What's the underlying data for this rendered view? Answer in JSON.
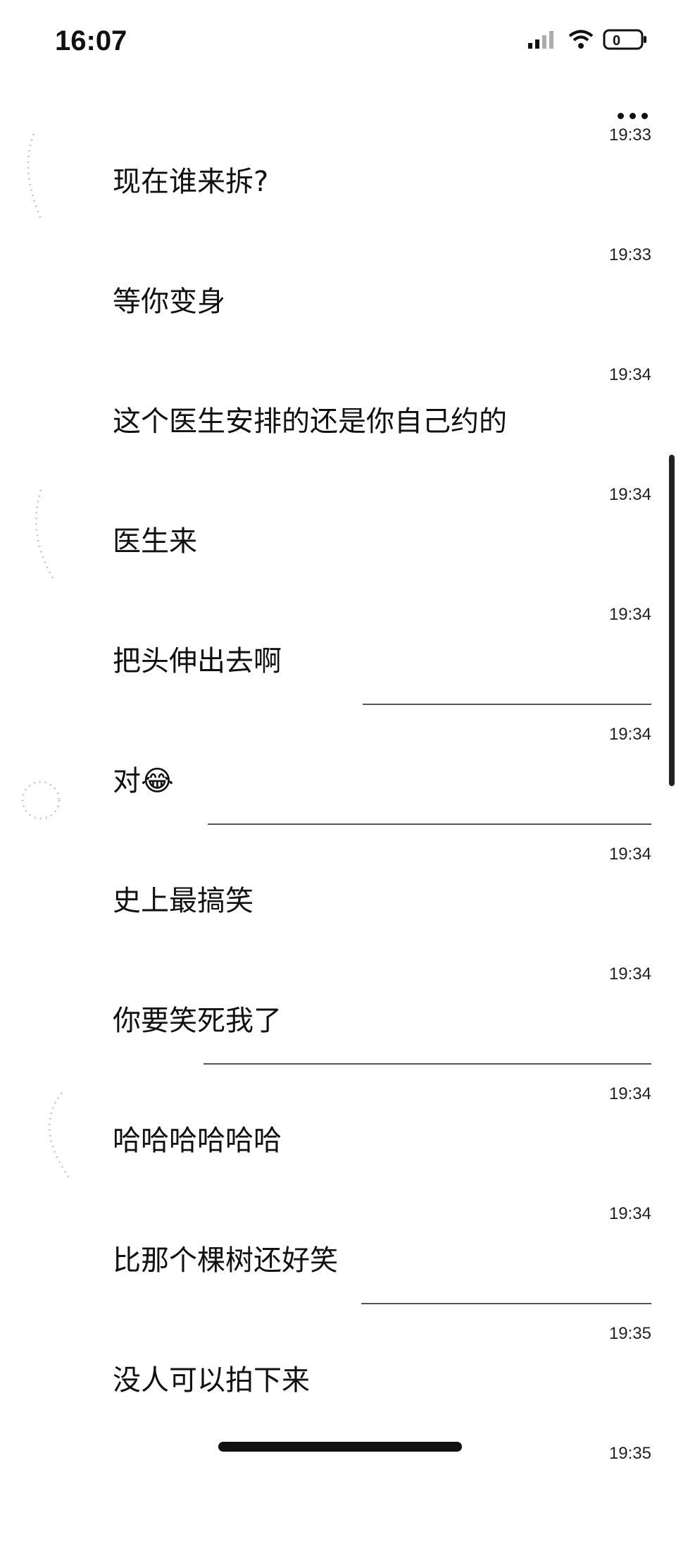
{
  "status": {
    "time": "16:07",
    "signal_icon": "signal-icon",
    "wifi_icon": "wifi-icon",
    "battery_icon": "battery-icon",
    "battery_level": "0"
  },
  "messages": [
    {
      "time": "19:33",
      "text": "现在谁来拆?"
    },
    {
      "time": "19:33",
      "text": "等你变身"
    },
    {
      "time": "19:34",
      "text": "这个医生安排的还是你自己约的"
    },
    {
      "time": "19:34",
      "text": "医生来"
    },
    {
      "time": "19:34",
      "text": "把头伸出去啊"
    },
    {
      "time": "19:34",
      "text": "对😂"
    },
    {
      "time": "19:34",
      "text": "史上最搞笑"
    },
    {
      "time": "19:34",
      "text": "你要笑死我了"
    },
    {
      "time": "19:34",
      "text": "哈哈哈哈哈哈"
    },
    {
      "time": "19:34",
      "text": "比那个棵树还好笑"
    },
    {
      "time": "19:35",
      "text": "没人可以拍下来"
    },
    {
      "time": "19:35",
      "text": ""
    }
  ]
}
